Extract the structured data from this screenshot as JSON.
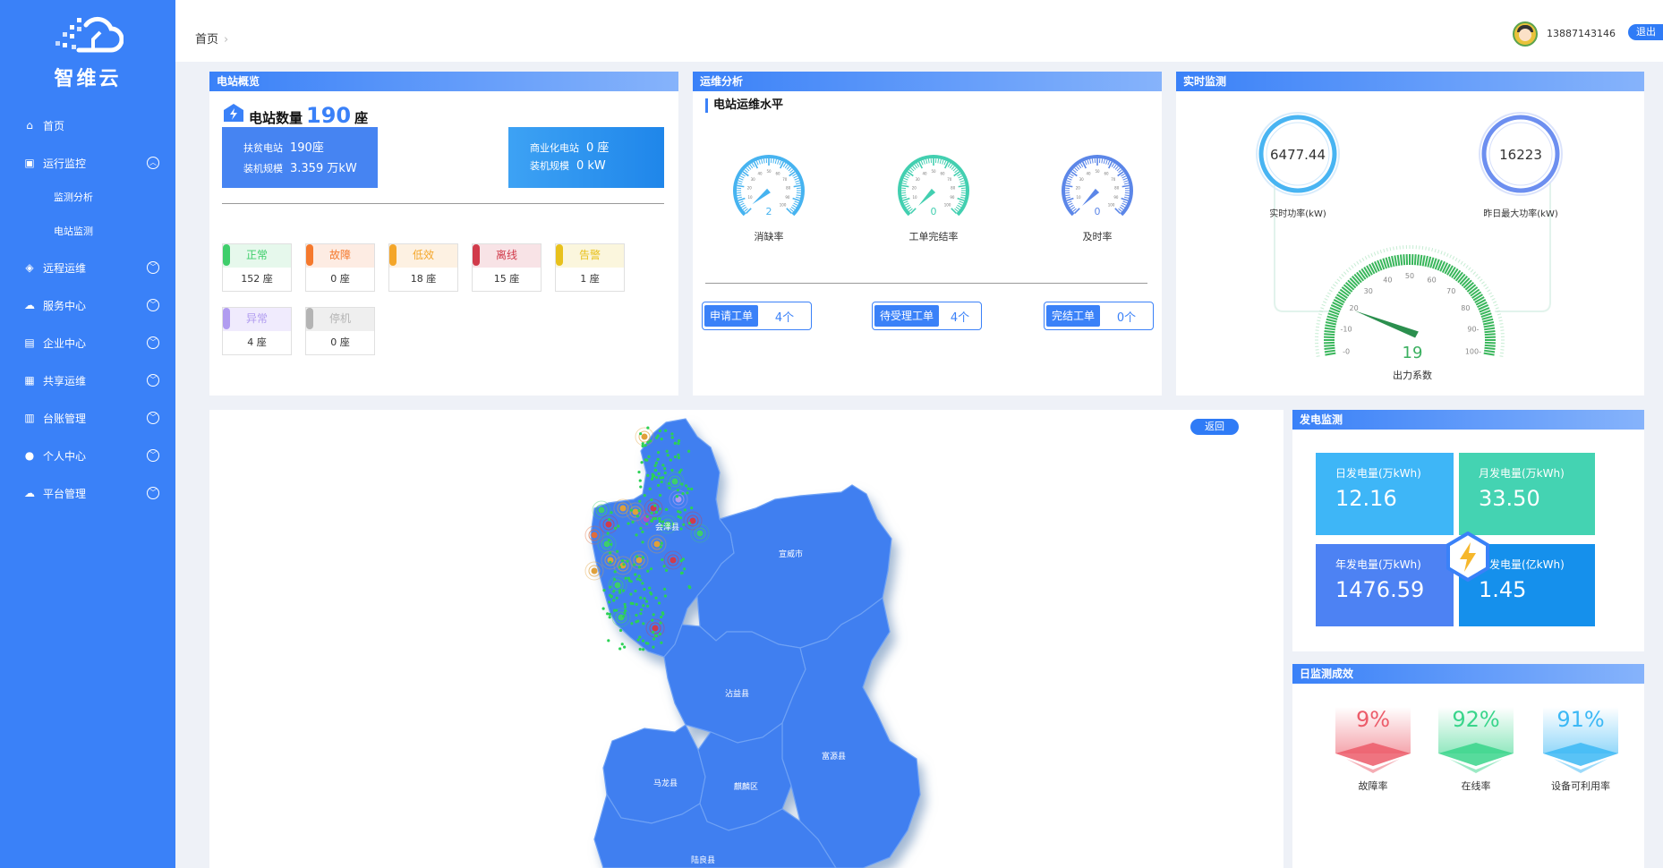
{
  "brand": {
    "name": "智维云"
  },
  "sidebar": {
    "items": [
      {
        "label": "首页",
        "icon": "home-icon"
      },
      {
        "label": "运行监控",
        "icon": "monitor-icon",
        "expanded": true
      },
      {
        "label": "远程运维",
        "icon": "remote-icon"
      },
      {
        "label": "服务中心",
        "icon": "service-icon"
      },
      {
        "label": "企业中心",
        "icon": "enterprise-icon"
      },
      {
        "label": "共享运维",
        "icon": "share-icon"
      },
      {
        "label": "台账管理",
        "icon": "ledger-icon"
      },
      {
        "label": "个人中心",
        "icon": "user-icon"
      },
      {
        "label": "平台管理",
        "icon": "cloud-icon"
      }
    ],
    "sub_items": [
      {
        "label": "监测分析"
      },
      {
        "label": "电站监测"
      }
    ]
  },
  "header": {
    "breadcrumb": "首页",
    "phone": "13887143146",
    "logout": "退出"
  },
  "overview": {
    "title": "电站概览",
    "count_label": "电站数量",
    "count": "190",
    "count_unit": "座",
    "poverty": {
      "label1": "扶贫电站",
      "value1": "190座",
      "label2": "装机规模",
      "value2": "3.359 万kW"
    },
    "commercial": {
      "label1": "商业化电站",
      "value1": "0 座",
      "label2": "装机规模",
      "value2": "0 kW"
    },
    "statuses": [
      {
        "label": "正常",
        "count": "152 座",
        "color": "#3fce6b",
        "bg": "#e6f8ec",
        "fg": "#3fce6b"
      },
      {
        "label": "故障",
        "count": "0 座",
        "color": "#f5792d",
        "bg": "#fdece3",
        "fg": "#f5792d"
      },
      {
        "label": "低效",
        "count": "18 座",
        "color": "#f4a62a",
        "bg": "#fdf1e2",
        "fg": "#f4a62a"
      },
      {
        "label": "离线",
        "count": "15 座",
        "color": "#d13b4b",
        "bg": "#f8e3e6",
        "fg": "#d13b4b"
      },
      {
        "label": "告警",
        "count": "1 座",
        "color": "#e8c11c",
        "bg": "#fbf6dd",
        "fg": "#e8c11c"
      },
      {
        "label": "异常",
        "count": "4 座",
        "color": "#b19cf0",
        "bg": "#f0ebfd",
        "fg": "#b19cf0"
      },
      {
        "label": "停机",
        "count": "0 座",
        "color": "#b4b4b4",
        "bg": "#efefef",
        "fg": "#b4b4b4"
      }
    ]
  },
  "om": {
    "title": "运维分析",
    "subtitle": "电站运维水平",
    "gauges": [
      {
        "label": "消缺率",
        "value": 2,
        "color": "#46b3f0"
      },
      {
        "label": "工单完结率",
        "value": 0,
        "color": "#42cfb0"
      },
      {
        "label": "及时率",
        "value": 0,
        "color": "#5b86e8"
      }
    ],
    "gauge_ticks": [
      "10",
      "20",
      "30",
      "40",
      "50",
      "60",
      "70",
      "80",
      "90",
      "100"
    ],
    "work_orders": [
      {
        "label": "申请工单",
        "value": "4个"
      },
      {
        "label": "待受理工单",
        "value": "4个"
      },
      {
        "label": "完结工单",
        "value": "0个"
      }
    ]
  },
  "realtime": {
    "title": "实时监测",
    "power": {
      "value": "6477.44",
      "label": "实时功率(kW)"
    },
    "max_power": {
      "value": "16223",
      "label": "昨日最大功率(kW)"
    },
    "factor": {
      "value": 19,
      "label": "出力系数",
      "ticks": [
        "-0",
        "-10",
        "20",
        "30",
        "40",
        "50",
        "60",
        "70",
        "80",
        "90-",
        "100-"
      ]
    }
  },
  "map": {
    "back": "返回",
    "regions": [
      "会泽县",
      "宣威市",
      "沾益县",
      "马龙县",
      "麒麟区",
      "富源县",
      "陆良县"
    ]
  },
  "power_gen": {
    "title": "发电监测",
    "cards": [
      {
        "label": "日发电量(万kWh)",
        "value": "12.16",
        "color": "#3eb6f7"
      },
      {
        "label": "月发电量(万kWh)",
        "value": "33.50",
        "color": "#44d3b2"
      },
      {
        "label": "年发电量(万kWh)",
        "value": "1476.59",
        "color": "#4d82f3"
      },
      {
        "label": "总发电量(亿kWh)",
        "value": "1.45",
        "color": "#1590ec"
      }
    ]
  },
  "efficiency": {
    "title": "日监测成效",
    "items": [
      {
        "label": "故障率",
        "value": "9%",
        "color": "#ec5c6a"
      },
      {
        "label": "在线率",
        "value": "92%",
        "color": "#39d58b"
      },
      {
        "label": "设备可利用率",
        "value": "91%",
        "color": "#3cb8f5"
      }
    ]
  }
}
